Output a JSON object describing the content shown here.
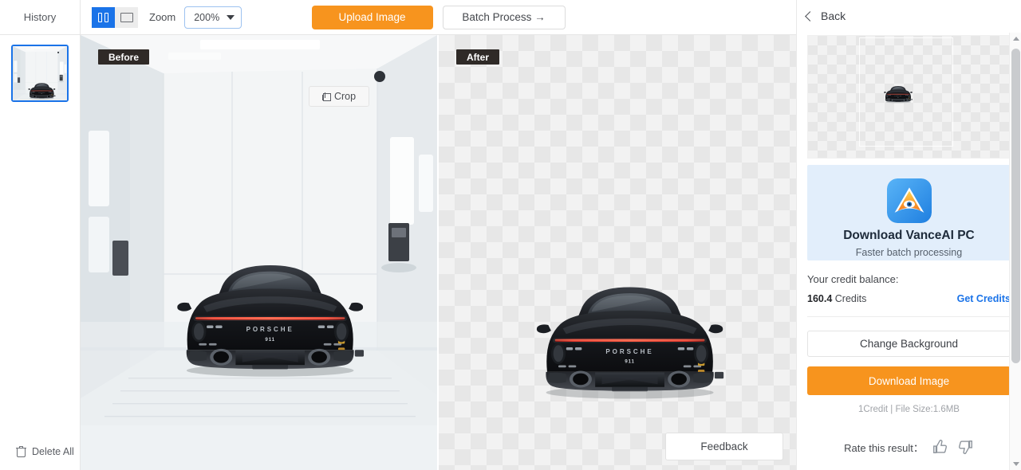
{
  "sidebar": {
    "header_title": "History",
    "delete_all_label": "Delete All",
    "delete_all_icon": "trash-icon",
    "thumbnail_alt": "black-porsche-911-in-white-studio"
  },
  "toolbar": {
    "view_split_icon": "split-view-icon",
    "view_single_icon": "single-view-icon",
    "zoom_label": "Zoom",
    "zoom_value": "200%",
    "zoom_caret_icon": "chevron-down-icon",
    "upload_label": "Upload Image",
    "batch_label": "Batch Process →",
    "accent_orange": "#f7941e",
    "accent_blue": "#1a73e8"
  },
  "canvas": {
    "before_tag": "Before",
    "after_tag": "After",
    "crop_label": "Crop",
    "crop_icon": "crop-icon",
    "feedback_label": "Feedback",
    "before_description": "Black Porsche 911 rear view inside a bright white studio room",
    "after_description": "Same Porsche 911 with background removed, shown on transparency checkerboard"
  },
  "right_panel": {
    "back_label": "Back",
    "back_icon": "chevron-left-icon",
    "preview_description": "Cut-out Porsche 911 preview on transparency checkerboard",
    "promo": {
      "logo_icon": "vanceai-logo-icon",
      "title": "Download VanceAI PC",
      "subtitle": "Faster batch processing"
    },
    "credit": {
      "label": "Your credit balance:",
      "amount": "160.4",
      "unit": "Credits",
      "get_credits_label": "Get Credits"
    },
    "change_background_label": "Change Background",
    "download_label": "Download Image",
    "file_meta": "1Credit | File Size:1.6MB",
    "rate": {
      "label": "Rate this result：",
      "thumbs_up_icon": "thumbs-up-icon",
      "thumbs_down_icon": "thumbs-down-icon"
    },
    "scrollbar": {
      "up_icon": "scroll-up-arrow-icon",
      "down_icon": "scroll-down-arrow-icon"
    }
  }
}
